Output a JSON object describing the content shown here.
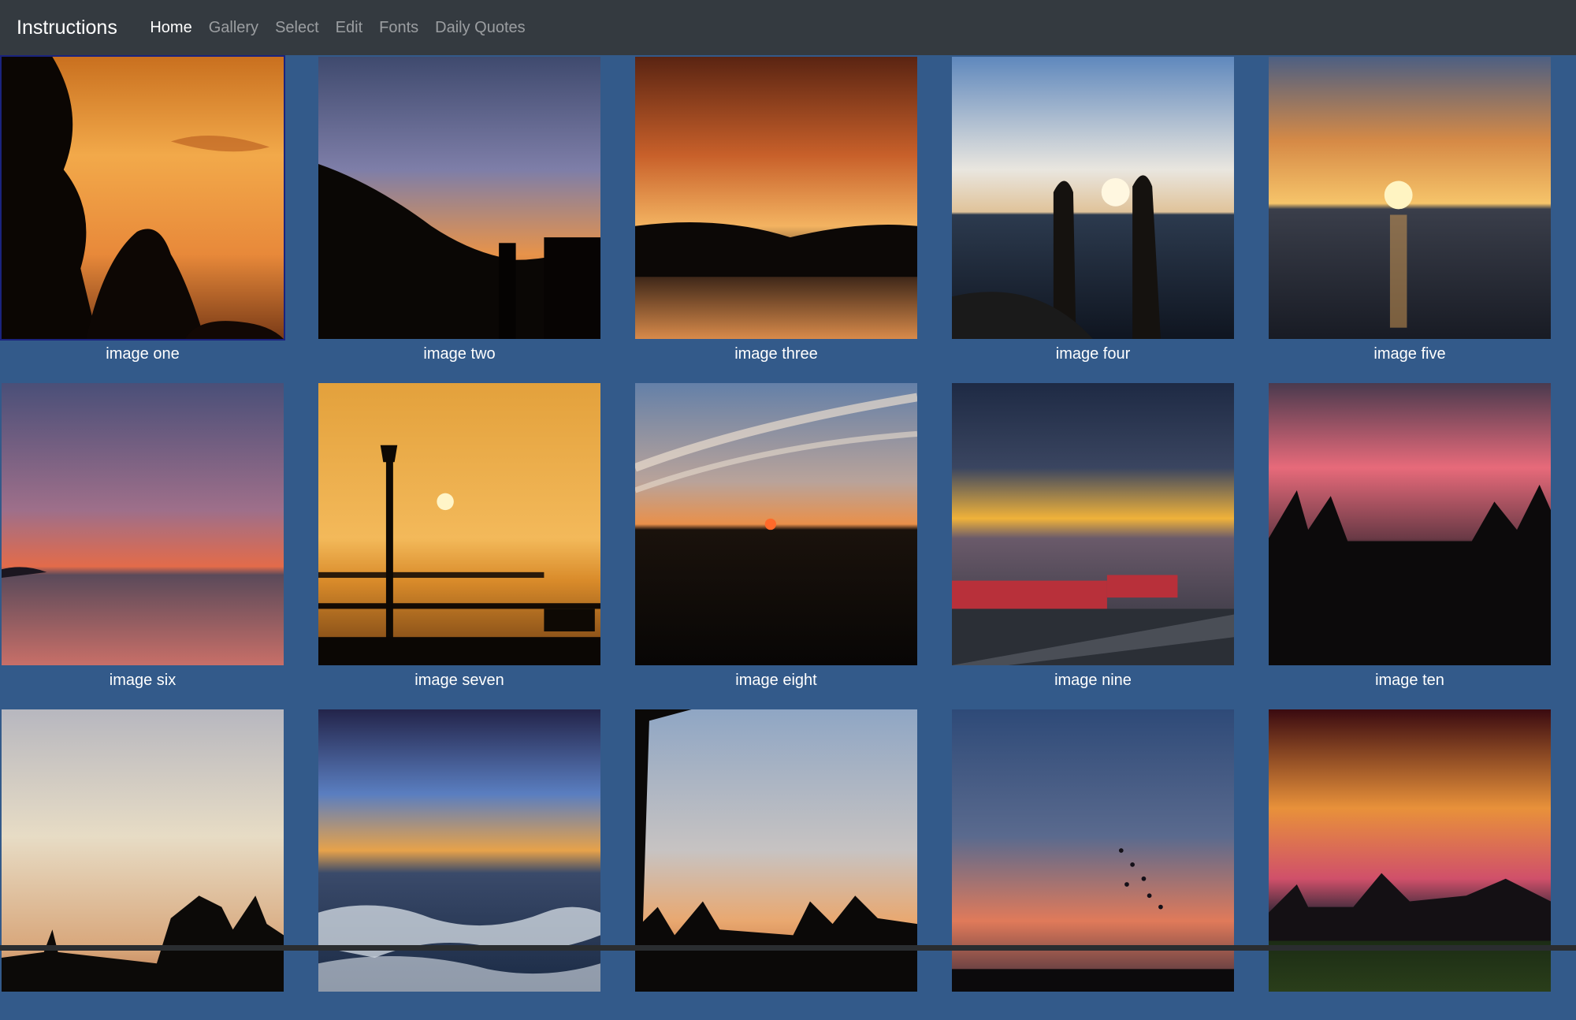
{
  "navbar": {
    "brand": "Instructions",
    "links": [
      {
        "label": "Home",
        "active": true
      },
      {
        "label": "Gallery",
        "active": false
      },
      {
        "label": "Select",
        "active": false
      },
      {
        "label": "Edit",
        "active": false
      },
      {
        "label": "Fonts",
        "active": false
      },
      {
        "label": "Daily Quotes",
        "active": false
      }
    ]
  },
  "gallery": {
    "images": [
      {
        "caption": "image one",
        "scene": "sunset-trees"
      },
      {
        "caption": "image two",
        "scene": "sunset-rooftops"
      },
      {
        "caption": "image three",
        "scene": "sunset-clouds-water"
      },
      {
        "caption": "image four",
        "scene": "sunset-feet-sea"
      },
      {
        "caption": "image five",
        "scene": "sunset-sun-sea"
      },
      {
        "caption": "image six",
        "scene": "dusk-horizon-sea"
      },
      {
        "caption": "image seven",
        "scene": "sunset-lamppost-pier"
      },
      {
        "caption": "image eight",
        "scene": "sunset-streaks-field"
      },
      {
        "caption": "image nine",
        "scene": "sunset-city"
      },
      {
        "caption": "image ten",
        "scene": "pink-sky-trees"
      },
      {
        "caption": "",
        "scene": "pale-sky-cypress"
      },
      {
        "caption": "",
        "scene": "blue-sky-waves"
      },
      {
        "caption": "",
        "scene": "dusk-palms"
      },
      {
        "caption": "",
        "scene": "dusk-birds"
      },
      {
        "caption": "",
        "scene": "red-sky-village"
      }
    ]
  }
}
